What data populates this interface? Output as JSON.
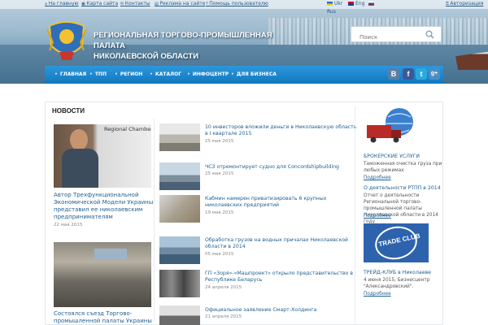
{
  "top_links": [
    "На главную",
    "Карта сайта",
    "Контакты",
    "Реклама на сайте",
    "Помощь пользователю",
    "Авторизация"
  ],
  "languages": [
    "Ukr",
    "Eng",
    "Rus"
  ],
  "site_title": [
    "РЕГИОНАЛЬНАЯ ТОРГОВО-ПРОМЫШЛЕННАЯ ПАЛАТА",
    "НИКОЛАЕВСКОЙ ОБЛАСТИ"
  ],
  "search": {
    "placeholder": "Поиск"
  },
  "nav": [
    "ГЛАВНАЯ",
    "ТПП",
    "РЕГИОН",
    "КАТАЛОГ",
    "ИНФОЦЕНТР",
    "ДЛЯ БИЗНЕСА"
  ],
  "social": [
    "B",
    "f",
    "t",
    "g+"
  ],
  "colors": {
    "nav": "#1a84ca",
    "link": "#1f5f91",
    "vk": "#5b7fa6",
    "fb": "#3b5998",
    "tw": "#2aa9e0",
    "gp": "#4b8ec2"
  },
  "news": {
    "heading": "НОВОСТИ",
    "featured": [
      {
        "title": "Автор Трехфункциональной Экономической Модели Украины представил ее николаевским предпринимателям",
        "date": "22 мая 2015",
        "img_text": "Regional Chamber of Commerce and I"
      },
      {
        "title": "Состоялся съезд Торгово-промышленной палаты Украины",
        "date": ""
      }
    ],
    "items": [
      {
        "title": "10 инвесторов вложили деньги в Николаевскую область в I квартале 2015",
        "date": "25 мая 2015"
      },
      {
        "title": "ЧСЗ отремонтирует судно для Concordshipbuilding",
        "date": "25 мая 2015"
      },
      {
        "title": "Кабмин намерен приватизировать 6 крупных николаевских предприятий",
        "date": "19 мая 2015"
      },
      {
        "title": "Обработка грузов на водных причалах Николаевской области в 2014",
        "date": "05 мая 2015"
      },
      {
        "title": "ГП «Зоря»-«Машпроект» открыло представительство в Республике Беларусь",
        "date": "24 апреля 2015"
      },
      {
        "title": "Официальное заявление Смарт-Холдинга",
        "date": "21 апреля 2015"
      }
    ]
  },
  "sidebar": {
    "brokerage": {
      "title": "БРОКЕРСКИЕ УСЛУГИ",
      "text": "Таможенная очистка груза при любых режимах",
      "more": "Подробнее"
    },
    "report": {
      "title": "О деятельности РТПП в 2014",
      "text": "Отчет о деятельности Региональной торгово-промышленной палаты Николаевской области в 2014 году",
      "more": "Подробнее"
    },
    "trade_club": {
      "title": "ТРЕЙД-КЛУБ в Николаеве",
      "text": "4 июня 2015, Бизнесцентр \"Александровский\".",
      "more": "Подробнее",
      "badge": "TRADE CLUB"
    }
  }
}
